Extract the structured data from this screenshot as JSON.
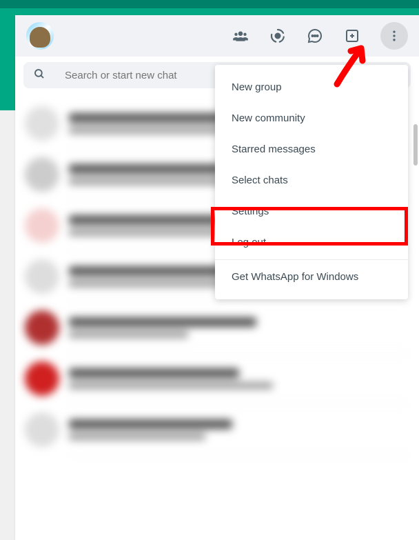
{
  "search": {
    "placeholder": "Search or start new chat"
  },
  "menu": {
    "new_group": "New group",
    "new_community": "New community",
    "starred_messages": "Starred messages",
    "select_chats": "Select chats",
    "settings": "Settings",
    "log_out": "Log out",
    "get_desktop": "Get WhatsApp for Windows"
  },
  "colors": {
    "teal_dark": "#008069",
    "teal": "#00a884",
    "highlight": "#ff0000"
  }
}
